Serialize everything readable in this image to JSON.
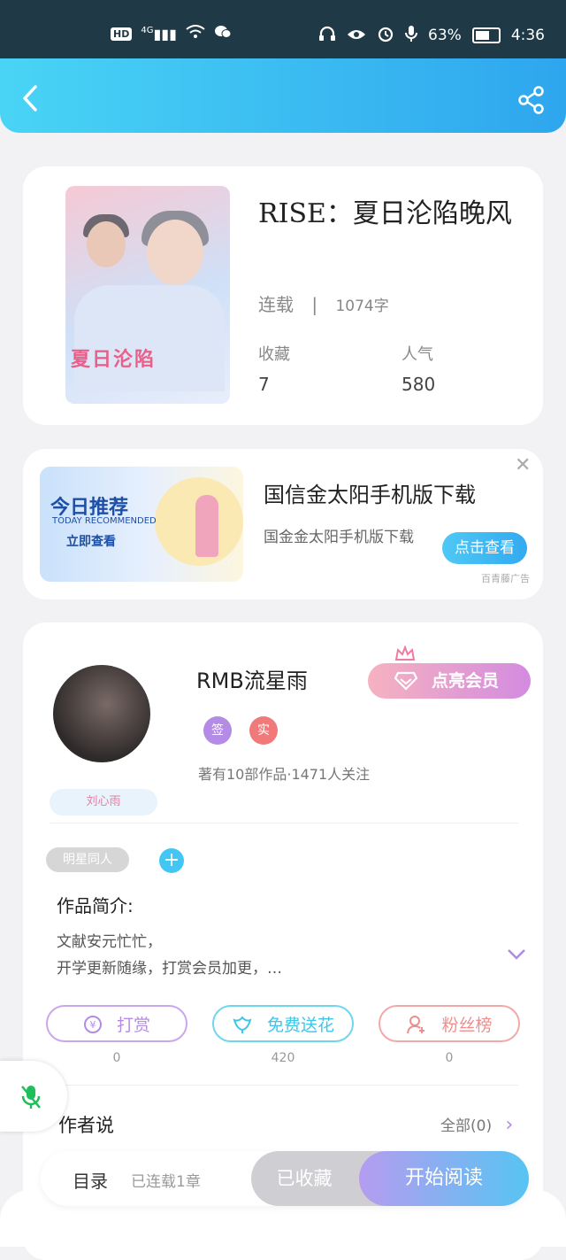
{
  "status_bar": {
    "left_icons": [
      "hd-icon",
      "signal-4g-icon",
      "wifi-icon",
      "wechat-icon"
    ],
    "network": "4G",
    "hd": "HD",
    "battery_percent": "63%",
    "battery_level": 0.63,
    "time": "4:36"
  },
  "header": {
    "back_icon": "back-arrow-icon",
    "share_icon": "share-icon"
  },
  "book": {
    "title": "RISE：夏日沦陷晚风",
    "status": "连载",
    "separator": "|",
    "word_count": "1074字",
    "favorites_label": "收藏",
    "favorites_value": "7",
    "popularity_label": "人气",
    "popularity_value": "580",
    "cover_text": "夏日沦陷"
  },
  "ad": {
    "banner_title": "今日推荐",
    "banner_subtitle": "TODAY RECOMMENDED",
    "banner_button": "立即查看",
    "title": "国信金太阳手机版下载",
    "description": "国金金太阳手机版下载",
    "button": "点击查看",
    "source": "百青藤广告",
    "close_label": "✕"
  },
  "author": {
    "name": "RMB流星雨",
    "badge_sign": "签",
    "badge_real": "实",
    "stats": "著有10部作品·1471人关注",
    "signature": "刘心雨",
    "vip_button": "点亮会员",
    "tag": "明星同人",
    "tag_add": "+",
    "intro_label": "作品简介:",
    "intro_line1": "文献安元忙忙，",
    "intro_line2": "开学更新随缘，打赏会员加更，…"
  },
  "actions": [
    {
      "label": "打赏",
      "icon": "yuan-icon",
      "count": "0",
      "color": "#b48ce6"
    },
    {
      "label": "免费送花",
      "icon": "flower-icon",
      "count": "420",
      "color": "#3ec6e8"
    },
    {
      "label": "粉丝榜",
      "icon": "fans-icon",
      "count": "0",
      "color": "#ef8e8e"
    }
  ],
  "author_says": {
    "label": "作者说",
    "all": "全部(0)"
  },
  "bottom_bar": {
    "toc": "目录",
    "toc_status": "已连载1章",
    "collected": "已收藏",
    "read": "开始阅读"
  },
  "colors": {
    "header_start": "#49d4f5",
    "header_end": "#2ea6ee",
    "accent_purple": "#b59cf0",
    "accent_blue": "#57c4f2"
  }
}
